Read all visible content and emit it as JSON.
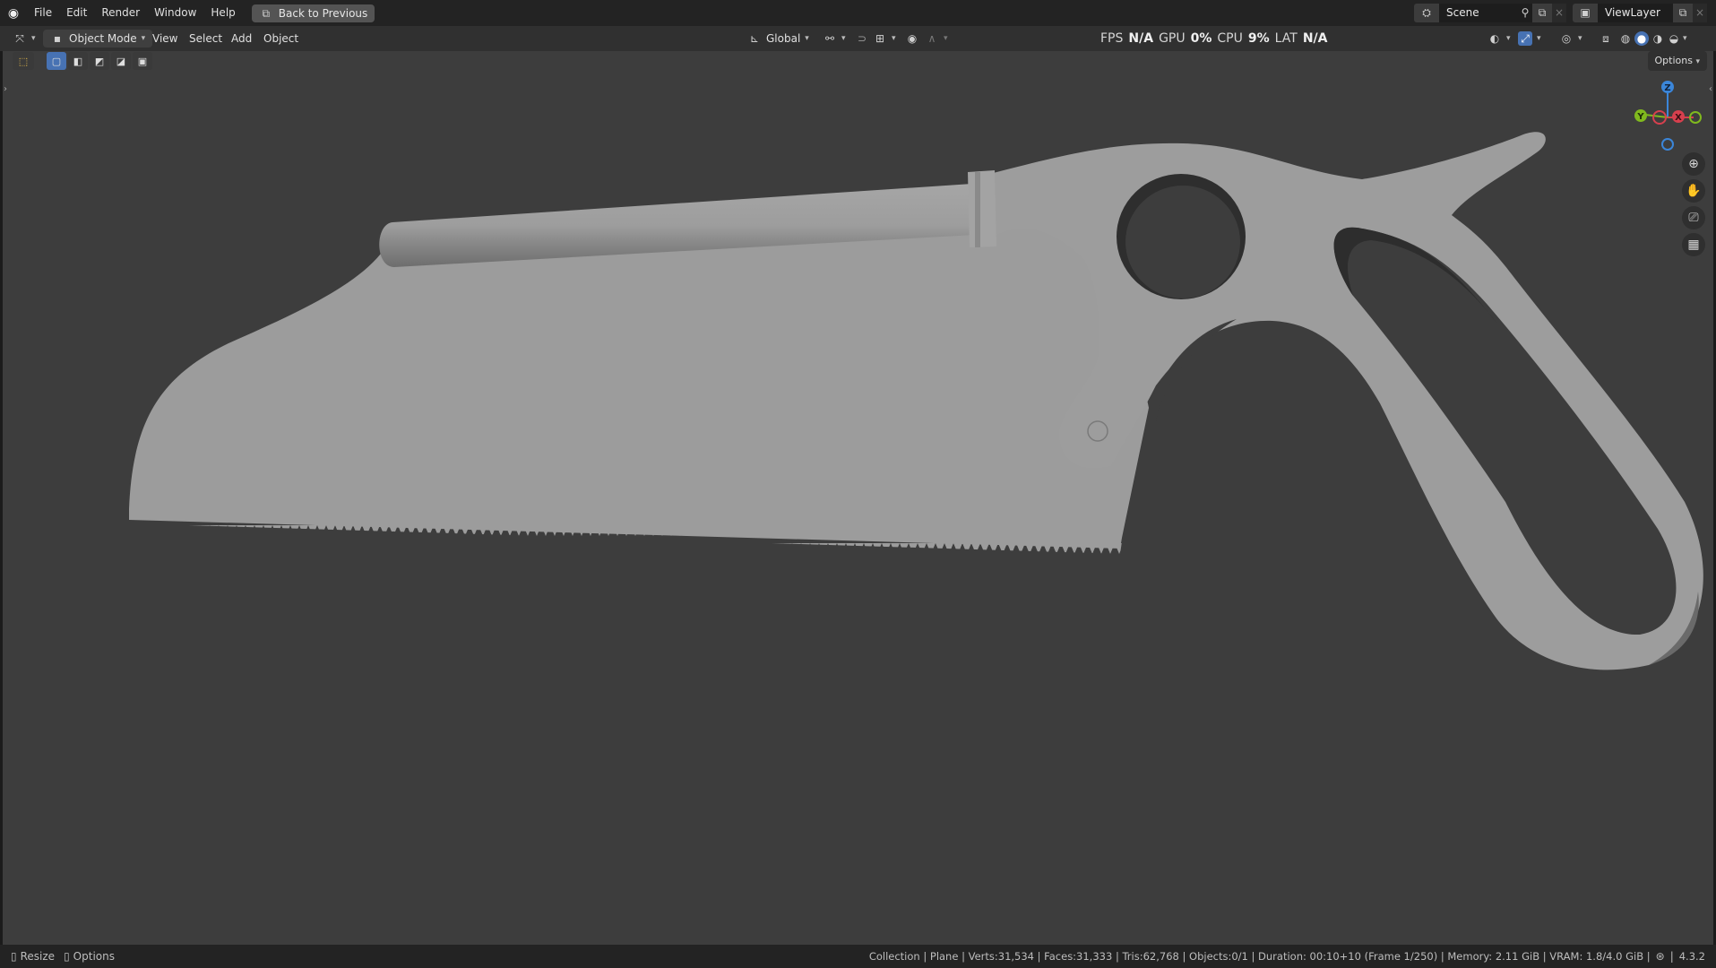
{
  "topbar": {
    "menus": [
      "File",
      "Edit",
      "Render",
      "Window",
      "Help"
    ],
    "back_button": "Back to Previous",
    "scene_name": "Scene",
    "viewlayer_name": "ViewLayer"
  },
  "header": {
    "mode": "Object Mode",
    "menus": [
      "View",
      "Select",
      "Add",
      "Object"
    ],
    "orientation": "Global"
  },
  "stats": {
    "fps_label": "FPS",
    "fps_value": "N/A",
    "gpu_label": "GPU",
    "gpu_value": "0%",
    "cpu_label": "CPU",
    "cpu_value": "9%",
    "lat_label": "LAT",
    "lat_value": "N/A"
  },
  "viewport": {
    "options_label": "Options",
    "gizmo": {
      "z": "Z",
      "y": "Y",
      "x": "X"
    }
  },
  "statusbar": {
    "left_action_1": "Resize",
    "left_action_2": "Options",
    "info": "Collection | Plane | Verts:31,534 | Faces:31,333 | Tris:62,768 | Objects:0/1 | Duration: 00:10+10 (Frame 1/250) | Memory: 2.11 GiB | VRAM: 1.8/4.0 GiB |",
    "version": "4.3.2"
  },
  "colors": {
    "accent": "#4772b3",
    "axis_x": "#d7404e",
    "axis_y": "#80b91e",
    "axis_z": "#3b86d9"
  }
}
